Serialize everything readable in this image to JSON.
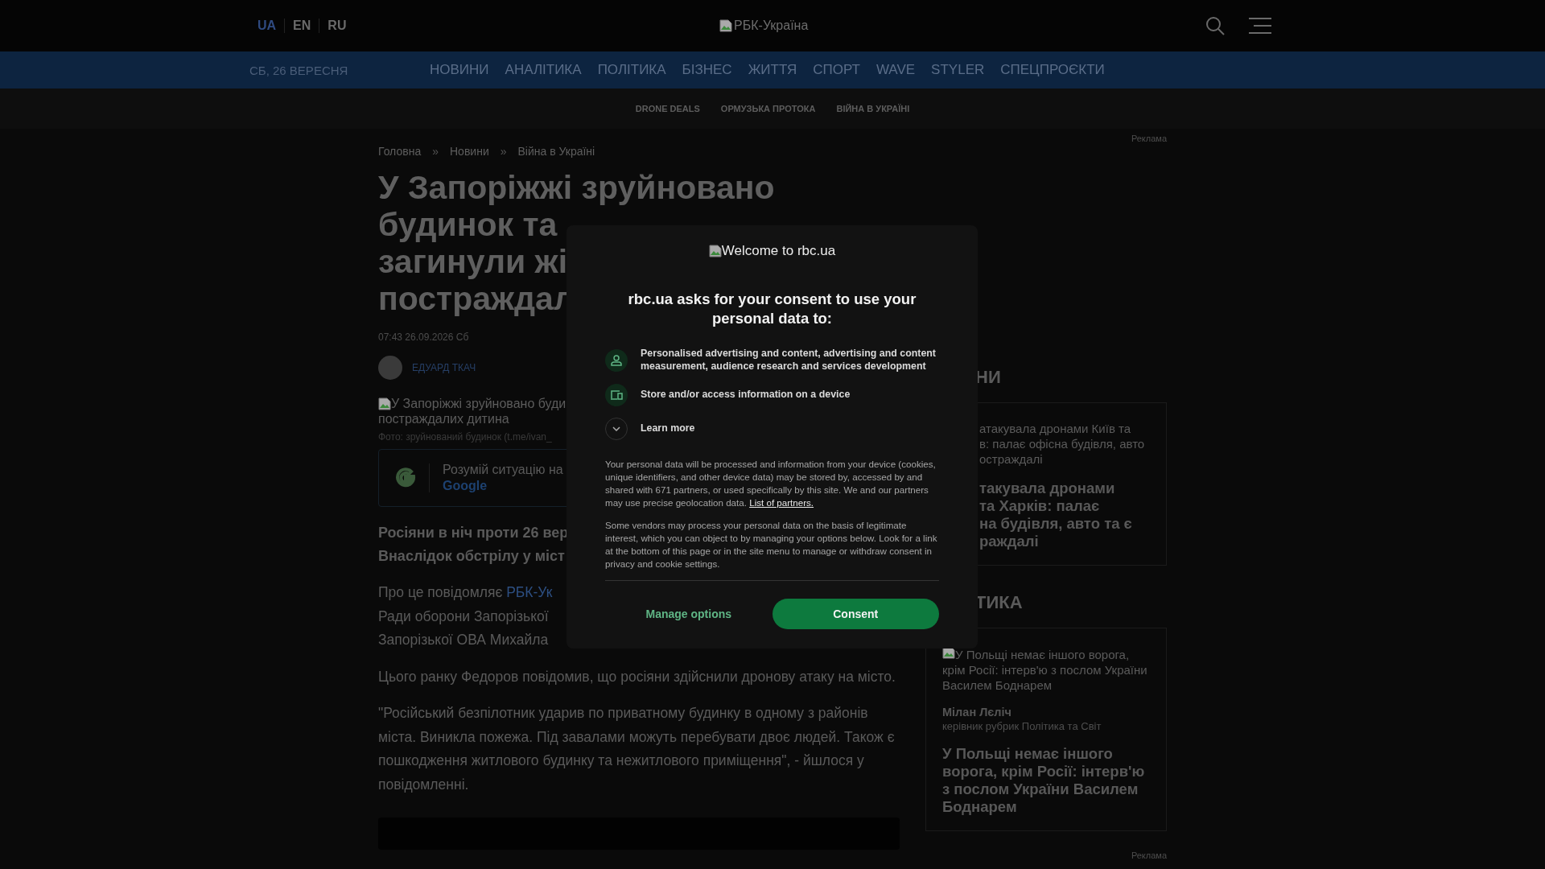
{
  "header": {
    "languages": [
      {
        "label": "UA",
        "selected": true
      },
      {
        "label": "EN",
        "selected": false
      },
      {
        "label": "RU",
        "selected": false
      }
    ],
    "logo_alt": "РБК-Україна"
  },
  "nav": {
    "date": "СБ, 26 ВЕРЕСНЯ",
    "items": [
      "НОВИНИ",
      "АНАЛІТИКА",
      "ПОЛІТИКА",
      "БІЗНЕС",
      "ЖИТТЯ",
      "СПОРТ",
      "WAVE",
      "STYLER",
      "СПЕЦПРОЄКТИ"
    ]
  },
  "subnav": [
    "DRONE DEALS",
    "ОРМУЗЬКА ПРОТОКА",
    "ВІЙНА В УКРАЇНІ"
  ],
  "ad_label": "Реклама",
  "breadcrumbs": {
    "items": [
      "Головна",
      "Новини",
      "Війна в Україні"
    ],
    "separator": "»"
  },
  "article": {
    "title_lines": [
      "У Запоріжжі зруйновано",
      "будинок та",
      "загинули жі",
      "постраждал"
    ],
    "datetime": "07:43 26.09.2026 Сб",
    "author": "ЕДУАРД ТКАЧ",
    "image_alt_lines": [
      "У Запоріжжі зруйновано буди",
      "постраждалих дитина"
    ],
    "photo_caption": "Фото: зруйнований будинок (t.me/ivan_",
    "google_promo": {
      "text": "Розумій ситуацію на",
      "brand": "Google"
    },
    "lead_lines": [
      "Росіяни в ніч проти 26 вер",
      "Внаслідок обстрілу у міст"
    ],
    "paragraphs": [
      {
        "lines": [
          [
            {
              "kind": "text",
              "text": "Про це повідомляє "
            },
            {
              "kind": "link",
              "text": "РБК-Ук"
            }
          ],
          [
            {
              "kind": "text",
              "text": "Ради оборони Запорізької"
            }
          ],
          [
            {
              "kind": "text",
              "text": "Запорізької ОВА Михайла"
            }
          ]
        ]
      },
      {
        "lines": [
          [
            {
              "kind": "text",
              "text": "Цього ранку Федоров повідомив, що росіяни здійснили дронову атаку на місто."
            }
          ]
        ]
      },
      {
        "lines": [
          [
            {
              "kind": "text",
              "text": "\"Російський безпілотник ударив по приватному будинку в одному з районів міста. Виникла пожежа. Під завалами можуть перебувати двоє людей. Також є пошкодження житлового будинку та нежитлового приміщення\", - йшлося у повідомленні."
            }
          ]
        ]
      }
    ]
  },
  "sidebar": {
    "sections": [
      {
        "heading": "НИ",
        "card": {
          "kind": "news",
          "image_alt_lines": [
            "атакувала дронами Київ та",
            "в: палає офісна будівля, авто",
            "остраждалі"
          ],
          "title_lines": [
            "такувала дронами",
            "та Харків: палає",
            "на будівля, авто та є",
            "раждалі"
          ]
        }
      },
      {
        "heading": "ТИКА",
        "card": {
          "kind": "interview",
          "image_alt": "У Польщі немає іншого ворога, крім Росії: інтерв'ю з послом України Василем Боднарем",
          "author": "Мілан Лєліч",
          "author_role": "керівник рубрик Політика та Світ",
          "title": "У Польщі немає іншого ворога, крім Росії: інтерв'ю з послом України Василем Боднарем"
        }
      }
    ]
  },
  "ad_label_bottom": "Реклама",
  "consent": {
    "logo_alt": "Welcome to rbc.ua",
    "heading": "rbc.ua asks for your consent to use your personal data to:",
    "purposes": [
      {
        "kind": "person",
        "text": "Personalised advertising and content, advertising and content measurement, audience research and services development"
      },
      {
        "kind": "device",
        "text": "Store and/or access information on a device"
      }
    ],
    "learn_more": {
      "label": "Learn more",
      "expanded": false
    },
    "body": "Your personal data will be processed and information from your device (cookies, unique identifiers, and other device data) may be stored by, accessed by and shared with 671 partners, or used specifically by this site. We and our partners may use precise geolocation data.",
    "partners_link": "List of partners.",
    "notice": "Some vendors may process your personal data on the basis of legitimate interest, which you can object to by managing your options below. Look for a link at the bottom of this page or in the site menu to manage or withdraw consent in privacy and cookie settings.",
    "manage_button": "Manage options",
    "consent_button": "Consent"
  }
}
